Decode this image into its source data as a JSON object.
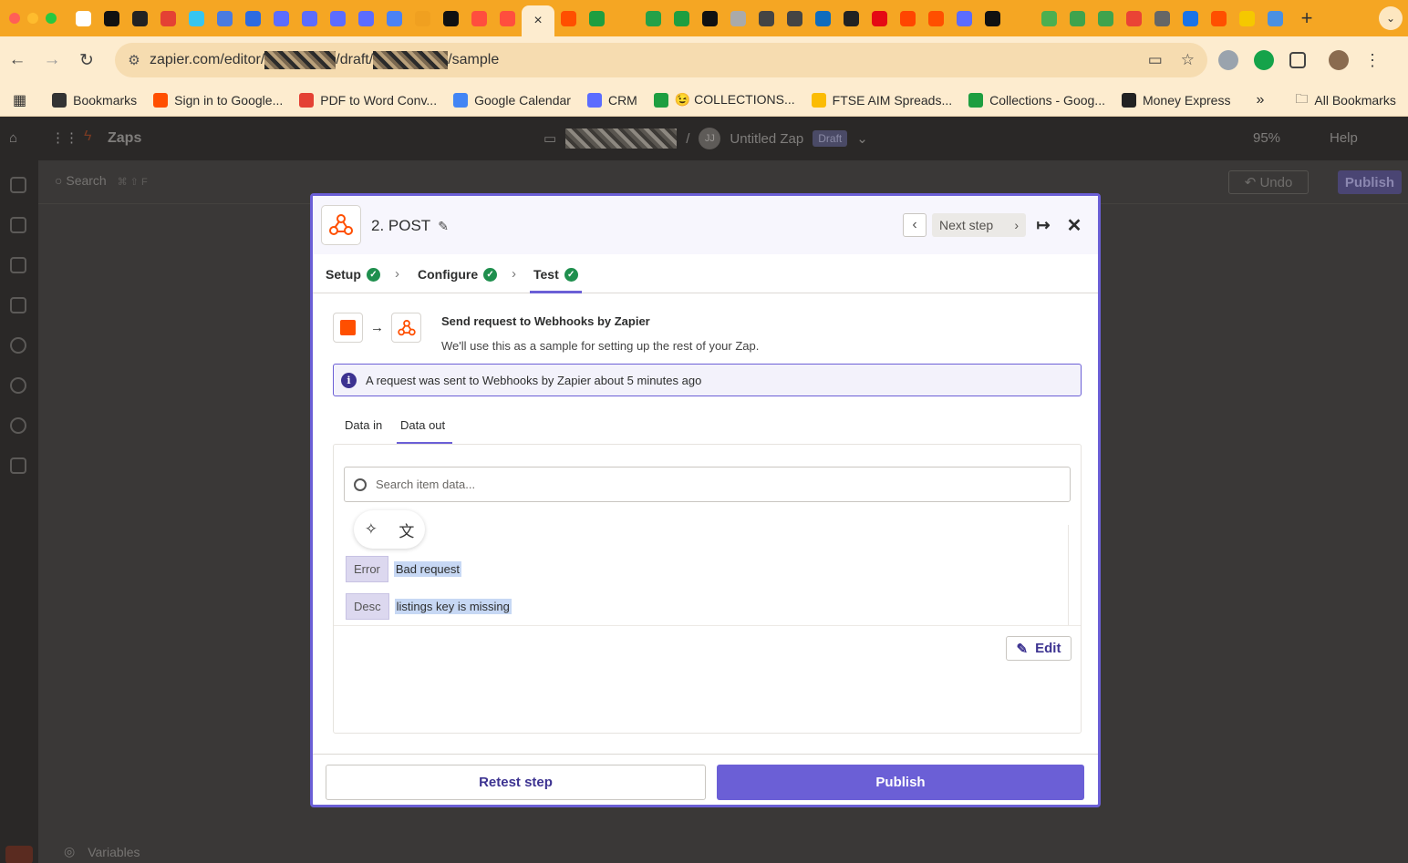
{
  "browser": {
    "tab_close": "×",
    "new_tab": "+",
    "url_prefix": "zapier.com/editor/",
    "url_middle": "/draft/",
    "url_suffix": "/sample",
    "tab_colors": [
      "#ffffff",
      "#111111",
      "#222222",
      "#e44134",
      "#36c5f0",
      "#4a7be0",
      "#2d6be0",
      "#5b6cff",
      "#5b6cff",
      "#5b6cff",
      "#5b6cff",
      "#4a82f5",
      "#f0a020",
      "#111111",
      "#ff4e3e",
      "#ff4e3e"
    ],
    "tab_colors_after": [
      "#ff4f00",
      "#1e9e40",
      "#f5a623",
      "#24a148",
      "#1e9e40",
      "#111111",
      "#aaaaaa",
      "#444444",
      "#444444",
      "#0f6cbd",
      "#222222",
      "#e50914",
      "#ff4500",
      "#ff4f00",
      "#5b6cff",
      "#111111",
      "#f5a623",
      "#4caf50",
      "#3fa34d",
      "#3fa34d",
      "#ea4335",
      "#666666",
      "#1a73e8",
      "#ff4f00",
      "#f5c800",
      "#4a90e2"
    ]
  },
  "bookmarks": {
    "items": [
      {
        "label": "Bookmarks",
        "color": "#333333",
        "icon": "star-icon"
      },
      {
        "label": "Sign in to Google...",
        "color": "#ff4f00",
        "icon": "zapier-icon"
      },
      {
        "label": "PDF to Word Conv...",
        "color": "#e44134",
        "icon": "pdf-icon"
      },
      {
        "label": "Google Calendar",
        "color": "#4285f4",
        "icon": "calendar-icon"
      },
      {
        "label": "CRM",
        "color": "#5b6cff",
        "icon": "crm-icon"
      },
      {
        "label": "😉 COLLECTIONS...",
        "color": "#1e9e40",
        "icon": "sheets-icon"
      },
      {
        "label": "FTSE AIM Spreads...",
        "color": "#fbbc04",
        "icon": "drive-icon"
      },
      {
        "label": "Collections - Goog...",
        "color": "#1e9e40",
        "icon": "sheets-icon"
      },
      {
        "label": "Money Express",
        "color": "#222222",
        "icon": "globe-icon"
      }
    ],
    "overflow": "»",
    "all_bookmarks": "All Bookmarks"
  },
  "app": {
    "zaps_label": "Zaps",
    "zap_name": "Untitled Zap",
    "avatar_initials": "JJ",
    "draft_badge": "Draft",
    "zoom": "95%",
    "help": "Help",
    "search_label": "Search",
    "shortcut": "⌘ ⇧ F",
    "undo": "Undo",
    "publish_bg": "Publish",
    "variables": "Variables"
  },
  "modal": {
    "step_title": "2. POST",
    "next_step": "Next step",
    "tabs": [
      {
        "label": "Setup"
      },
      {
        "label": "Configure"
      },
      {
        "label": "Test"
      }
    ],
    "send_title": "Send request to Webhooks by Zapier",
    "send_desc": "We'll use this as a sample for setting up the rest of your Zap.",
    "info": "A request was sent to Webhooks by Zapier about 5 minutes ago",
    "data_tabs": {
      "in": "Data in",
      "out": "Data out"
    },
    "search_placeholder": "Search item data...",
    "rows": [
      {
        "key": "Error",
        "value": "Bad request"
      },
      {
        "key": "Desc",
        "value": "listings key is missing"
      }
    ],
    "edit": "Edit",
    "retest": "Retest step",
    "publish": "Publish"
  }
}
